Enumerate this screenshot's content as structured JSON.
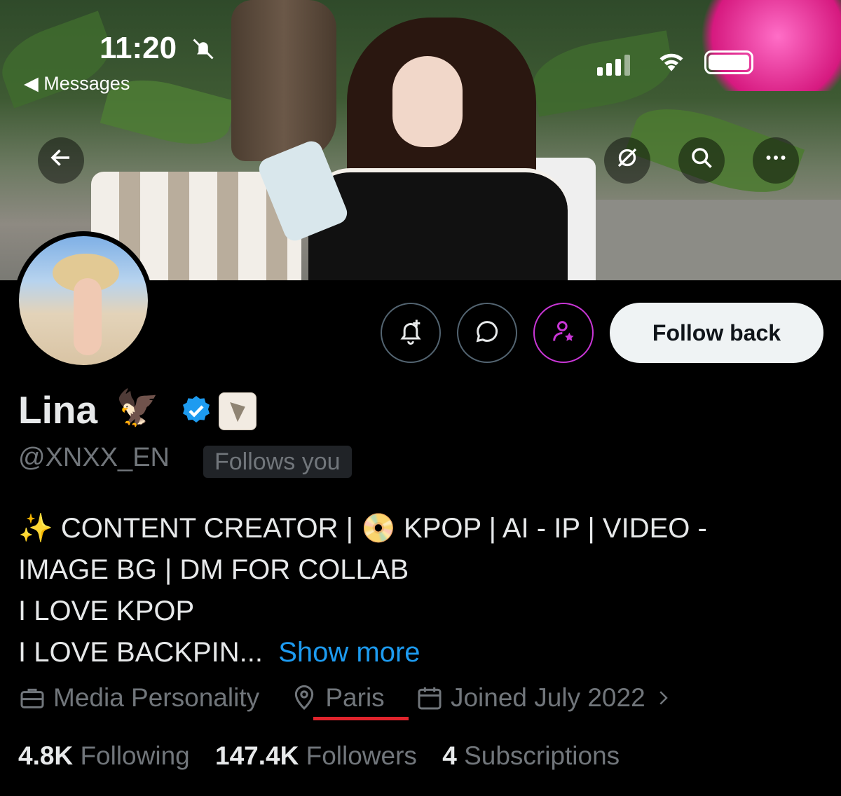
{
  "status_bar": {
    "time": "11:20",
    "back_app_label": "◀ Messages"
  },
  "profile": {
    "name": "Lina",
    "handle": "@XNXX_EN",
    "follows_you_label": "Follows you",
    "follow_button_label": "Follow back",
    "verified_color": "#1d9bf0",
    "bio_lines": [
      "✨ CONTENT CREATOR | 📀 KPOP | AI - IP | VIDEO -",
      "IMAGE BG | DM FOR COLLAB",
      "I LOVE KPOP",
      "I LOVE BACKPIN..."
    ],
    "show_more_label": "Show more",
    "category": "Media Personality",
    "location": "Paris",
    "joined": "Joined July 2022",
    "stats": {
      "following_count": "4.8K",
      "following_label": "Following",
      "followers_count": "147.4K",
      "followers_label": "Followers",
      "subscriptions_count": "4",
      "subscriptions_label": "Subscriptions"
    }
  },
  "icons": {
    "back": "arrow-left-icon",
    "grok": "grok-icon",
    "search": "search-icon",
    "more": "more-icon",
    "notify": "bell-plus-icon",
    "message": "message-icon",
    "subscribe": "subscribe-icon"
  },
  "colors": {
    "accent": "#1d9bf0",
    "subscribe": "#c936d6",
    "highlight_underline": "#e0242c"
  }
}
